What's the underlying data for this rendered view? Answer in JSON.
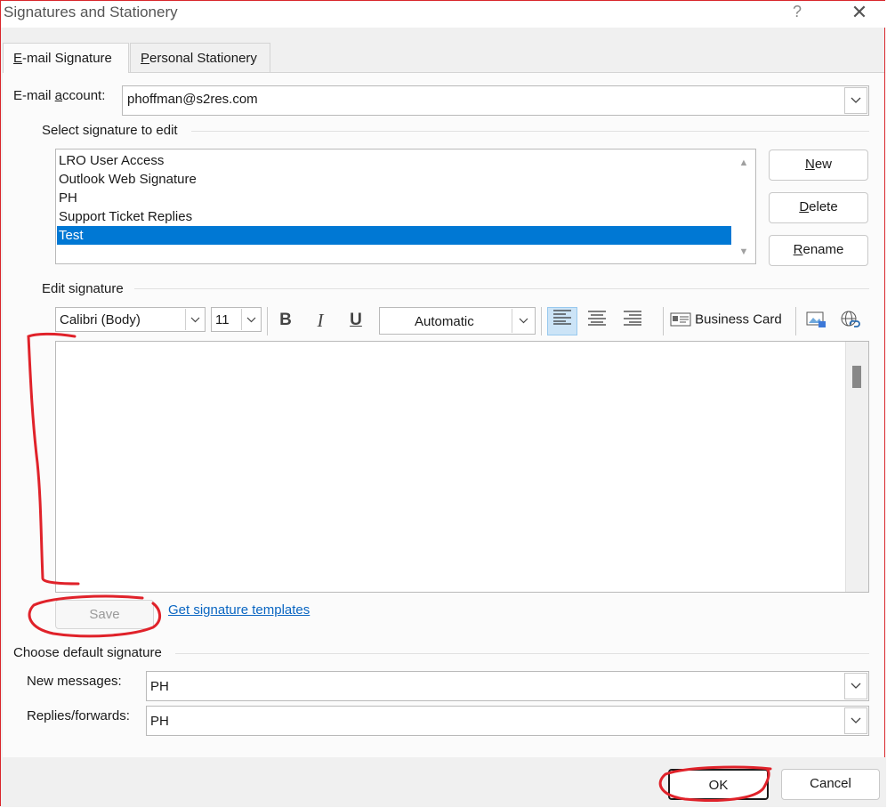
{
  "window": {
    "title": "Signatures and Stationery",
    "help": "?",
    "close": "✕"
  },
  "tabs": [
    {
      "label_pre": "",
      "label_ul": "E",
      "label_post": "-mail Signature"
    },
    {
      "label_pre": "",
      "label_ul": "P",
      "label_post": "ersonal Stationery"
    }
  ],
  "email_account": {
    "label_pre": "E-mail ",
    "label_ul": "a",
    "label_post": "ccount:",
    "value": "phoffman@s2res.com"
  },
  "select_signature": {
    "heading": "Select signature to edit",
    "items": [
      "LRO User Access",
      "Outlook Web Signature",
      "PH",
      "Support Ticket Replies",
      "Test"
    ],
    "selected_index": 4
  },
  "buttons": {
    "new": {
      "ul": "N",
      "rest": "ew"
    },
    "delete": {
      "ul": "D",
      "rest": "elete"
    },
    "rename": {
      "ul": "R",
      "rest": "ename"
    },
    "save": "Save",
    "ok": "OK",
    "cancel": "Cancel"
  },
  "edit_signature": {
    "heading": "Edit signature",
    "font": "Calibri (Body)",
    "size": "11",
    "color": "Automatic",
    "business_card": "Business Card"
  },
  "link_templates": "Get signature templates",
  "default_signature": {
    "heading": "Choose default signature",
    "new_label": "New messages:",
    "new_value": "PH",
    "replies_label": "Replies/forwards:",
    "replies_value": "PH"
  },
  "colors": {
    "selection": "#0078d4",
    "annotation": "#e0222a",
    "link": "#0a66c2"
  }
}
